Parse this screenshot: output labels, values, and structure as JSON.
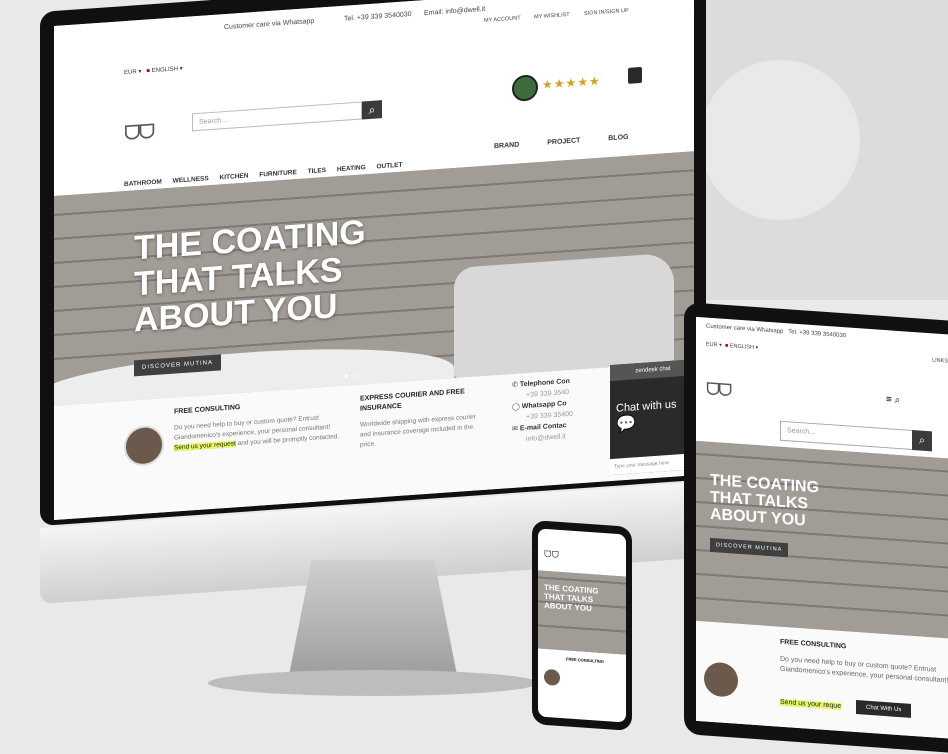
{
  "desktop": {
    "topbar": {
      "whatsapp": "Customer care via Whatsapp",
      "tel": "Tel. +39 339 3540030",
      "email": "Email: info@dwell.it",
      "my_account": "MY ACCOUNT",
      "wishlist": "MY WISHLIST",
      "signin": "SIGN IN/SIGN UP"
    },
    "currency": "EUR",
    "language": "ENGLISH",
    "logo": "ᗜᗜ",
    "search_placeholder": "Search...",
    "rating_stars": "★★★★★",
    "nav_left": [
      "BATHROOM",
      "WELLNESS",
      "KITCHEN",
      "FURNITURE",
      "TILES",
      "HEATING",
      "OUTLET"
    ],
    "nav_right": [
      "BRAND",
      "PROJECT",
      "BLOG"
    ],
    "hero": {
      "title_line1": "THE COATING",
      "title_line2": "THAT TALKS",
      "title_line3": "ABOUT YOU",
      "button": "DISCOVER MUTINA"
    },
    "consulting": {
      "title": "FREE CONSULTING",
      "text": "Do you need help to buy or custom quote? Entrust Giandomenico's experience, your personal consultant!",
      "link": "Send us your request",
      "text2": "and you will be promptly contacted."
    },
    "courier": {
      "title": "EXPRESS COURIER AND FREE INSURANCE",
      "text": "Worldwide shipping with express courier and insurance coverage included in the price."
    },
    "contacts": {
      "telephone": "Telephone Con",
      "telephone_num": "+39 339 3540",
      "whatsapp": "Whatsapp Co",
      "whatsapp_num": "+39 339 35400",
      "email": "E-mail Contac",
      "email_addr": "info@dwell.it"
    },
    "chat": {
      "header": "zendesk chat",
      "label": "Chat with us",
      "input_placeholder": "Type your message here"
    }
  },
  "tablet": {
    "topbar": "Customer care via Whatsapp",
    "tel": "Tel. +39 339 3540030",
    "currency": "EUR",
    "language": "ENGLISH",
    "links": "LINKS",
    "logo": "ᗜᗜ",
    "search_placeholder": "Search...",
    "hero": {
      "title_line1": "THE COATING",
      "title_line2": "THAT TALKS",
      "title_line3": "ABOUT YOU",
      "button": "DISCOVER MUTINA"
    },
    "consulting_title": "FREE CONSULTING",
    "consulting_text": "Do you need help to buy or custom quote? Entrust Giandomenico's experience, your personal consultant!",
    "link": "Send us your reque",
    "chat_label": "Chat With Us"
  },
  "phone": {
    "hero_line1": "THE COATING",
    "hero_line2": "THAT TALKS",
    "hero_line3": "ABOUT YOU",
    "consulting_title": "FREE CONSULTING"
  }
}
